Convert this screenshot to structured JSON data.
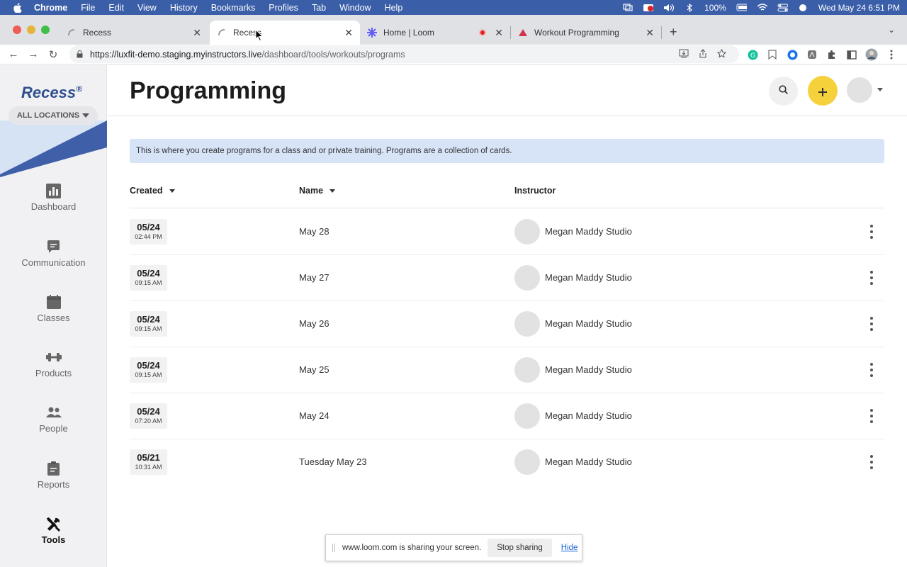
{
  "menubar": {
    "app": "Chrome",
    "items": [
      "File",
      "Edit",
      "View",
      "History",
      "Bookmarks",
      "Profiles",
      "Tab",
      "Window",
      "Help"
    ],
    "battery": "100%",
    "datetime": "Wed May 24  6:51 PM"
  },
  "tabs": [
    {
      "title": "Recess",
      "active": false
    },
    {
      "title": "Recess",
      "active": true
    },
    {
      "title": "Home | Loom",
      "active": false
    },
    {
      "title": "Workout Programming",
      "active": false
    }
  ],
  "address": {
    "host": "https://luxfit-demo.staging.myinstructors.live",
    "path": "/dashboard/tools/workouts/programs"
  },
  "sidebar": {
    "brand": "Recess",
    "brand_mark": "®",
    "location": "ALL LOCATIONS",
    "items": [
      {
        "label": "Dashboard",
        "icon": "chart-icon"
      },
      {
        "label": "Communication",
        "icon": "message-icon"
      },
      {
        "label": "Classes",
        "icon": "calendar-icon"
      },
      {
        "label": "Products",
        "icon": "dumbbell-icon"
      },
      {
        "label": "People",
        "icon": "people-icon"
      },
      {
        "label": "Reports",
        "icon": "clipboard-icon"
      },
      {
        "label": "Tools",
        "icon": "tools-icon",
        "active": true
      }
    ]
  },
  "page": {
    "title": "Programming",
    "info": "This is where you create programs for a class and or private training. Programs are a collection of cards."
  },
  "table": {
    "headers": {
      "created": "Created",
      "name": "Name",
      "instructor": "Instructor"
    },
    "rows": [
      {
        "date": "05/24",
        "time": "02:44 PM",
        "name": "May 28",
        "instructor": "Megan Maddy Studio"
      },
      {
        "date": "05/24",
        "time": "09:15 AM",
        "name": "May 27",
        "instructor": "Megan Maddy Studio"
      },
      {
        "date": "05/24",
        "time": "09:15 AM",
        "name": "May 26",
        "instructor": "Megan Maddy Studio"
      },
      {
        "date": "05/24",
        "time": "09:15 AM",
        "name": "May 25",
        "instructor": "Megan Maddy Studio"
      },
      {
        "date": "05/24",
        "time": "07:20 AM",
        "name": "May 24",
        "instructor": "Megan Maddy Studio"
      },
      {
        "date": "05/21",
        "time": "10:31 AM",
        "name": "Tuesday May 23",
        "instructor": "Megan Maddy Studio"
      }
    ]
  },
  "share": {
    "message": "www.loom.com is sharing your screen.",
    "stop_label": "Stop sharing",
    "hide_label": "Hide"
  },
  "colors": {
    "menubar": "#3a5ea8",
    "brand": "#2f4f8f",
    "accent_yellow": "#f5d23b",
    "info_bg": "#d7e3f7"
  }
}
